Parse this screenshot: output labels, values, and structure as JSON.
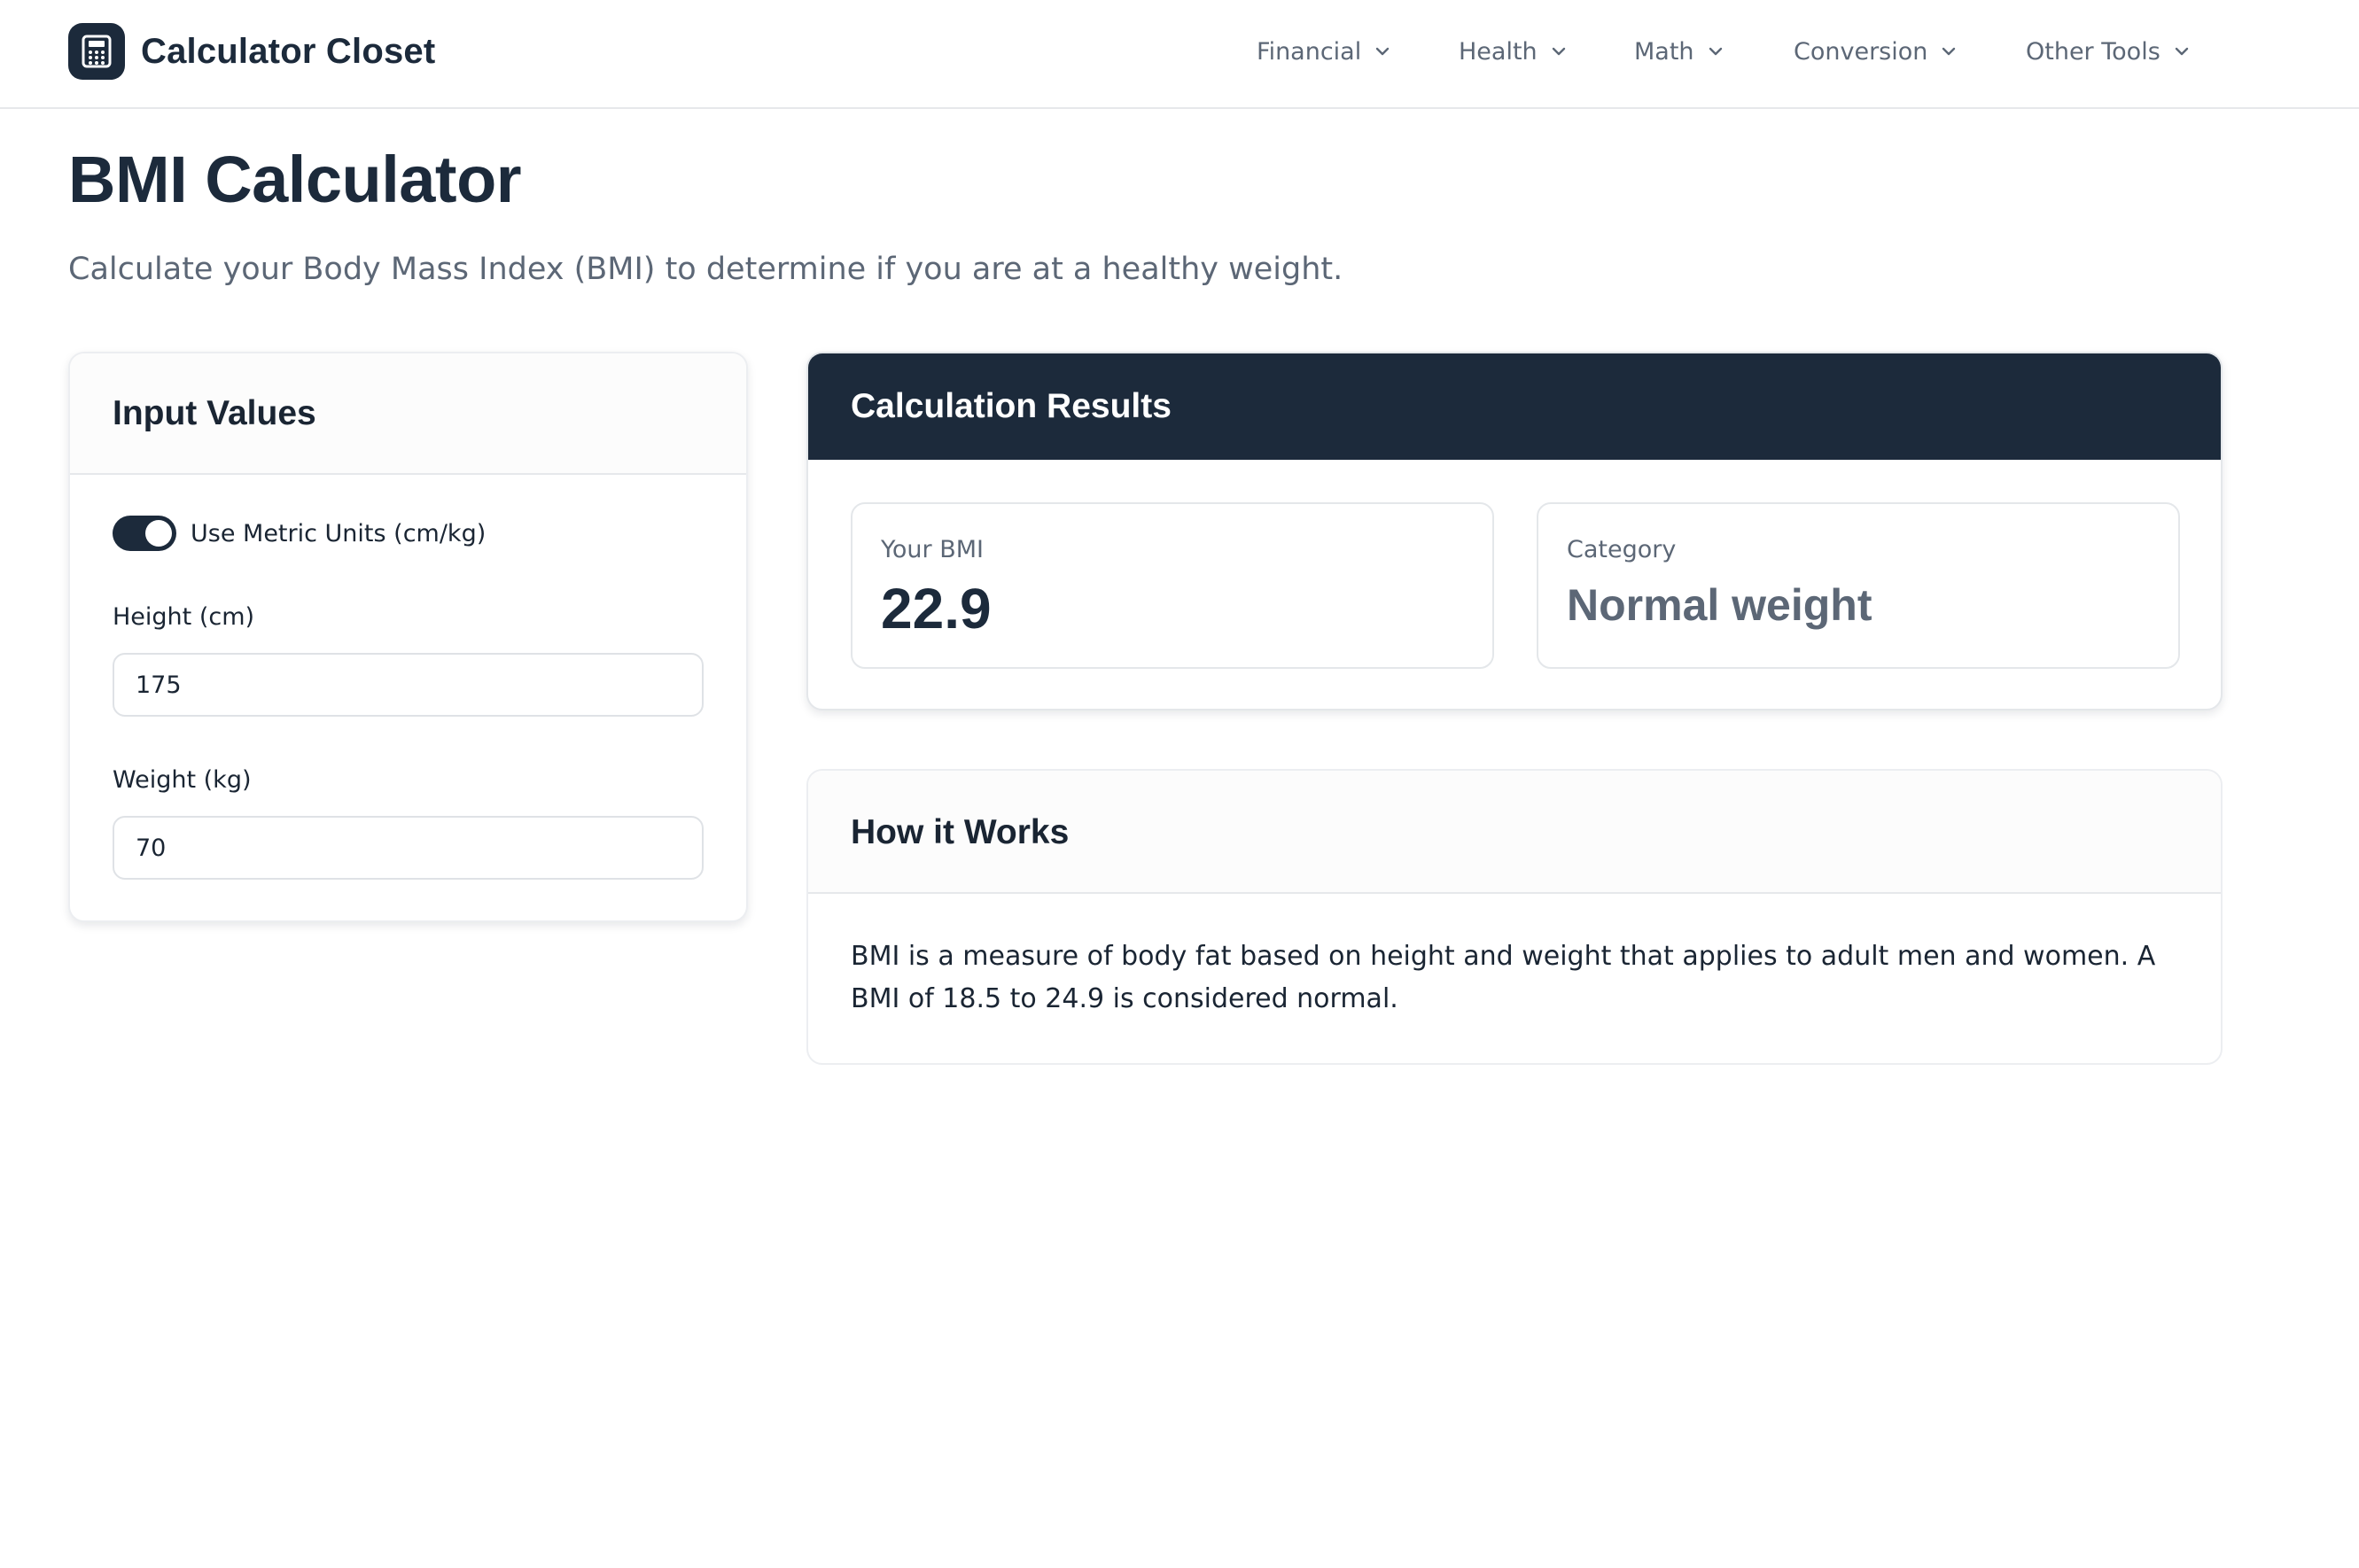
{
  "header": {
    "brand_name": "Calculator Closet",
    "logo_icon": "calculator-icon",
    "nav": [
      {
        "label": "Financial"
      },
      {
        "label": "Health"
      },
      {
        "label": "Math"
      },
      {
        "label": "Conversion"
      },
      {
        "label": "Other Tools"
      }
    ]
  },
  "page": {
    "title": "BMI Calculator",
    "subtitle": "Calculate your Body Mass Index (BMI) to determine if you are at a healthy weight."
  },
  "input_card": {
    "title": "Input Values",
    "metric_toggle": {
      "label": "Use Metric Units (cm/kg)",
      "on": true
    },
    "height": {
      "label": "Height (cm)",
      "value": "175"
    },
    "weight": {
      "label": "Weight (kg)",
      "value": "70"
    }
  },
  "results_card": {
    "title": "Calculation Results",
    "bmi": {
      "label": "Your BMI",
      "value": "22.9"
    },
    "category": {
      "label": "Category",
      "value": "Normal weight"
    }
  },
  "how_it_works": {
    "title": "How it Works",
    "body": "BMI is a measure of body fat based on height and weight that applies to adult men and women. A BMI of 18.5 to 24.9 is considered normal."
  },
  "colors": {
    "primary": "#1c2a3b",
    "muted_text": "#5c6776",
    "border": "#e6e8eb",
    "background": "#ffffff"
  }
}
